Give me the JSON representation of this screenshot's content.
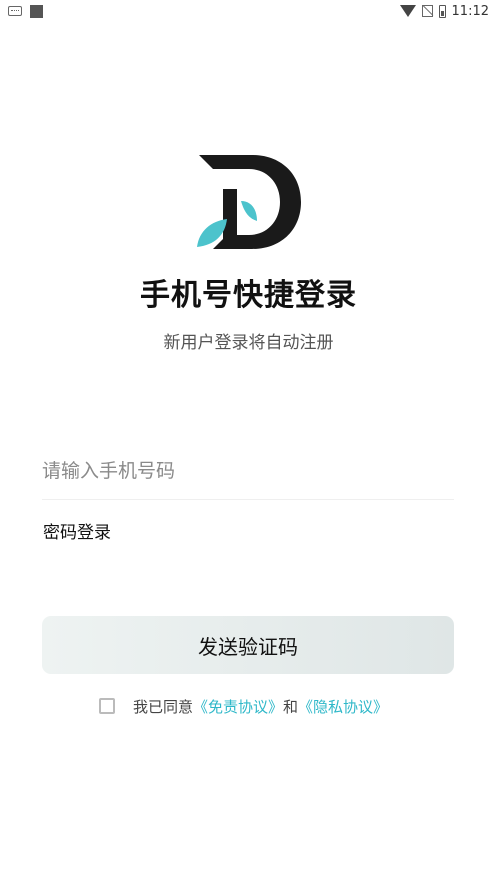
{
  "status_bar": {
    "time": "11:12",
    "icons": [
      "keyboard-icon",
      "square-icon",
      "wifi-icon",
      "no-sim-icon",
      "battery-icon"
    ]
  },
  "brand": {
    "logo_icon": "d-logo-icon",
    "colors": {
      "dark": "#1a1a1a",
      "accent": "#4cc3cc"
    }
  },
  "login": {
    "title": "手机号快捷登录",
    "subtitle": "新用户登录将自动注册",
    "phone_placeholder": "请输入手机号码",
    "phone_value": "",
    "password_login_label": "密码登录",
    "send_code_label": "发送验证码",
    "agreement": {
      "prefix": "我已同意",
      "disclaimer_link": "《免责协议》",
      "and": "和",
      "privacy_link": "《隐私协议》",
      "checked": false
    }
  },
  "colors": {
    "link": "#2fb8c9",
    "button_gradient": [
      "#eef3f2",
      "#dfe6e6"
    ]
  }
}
